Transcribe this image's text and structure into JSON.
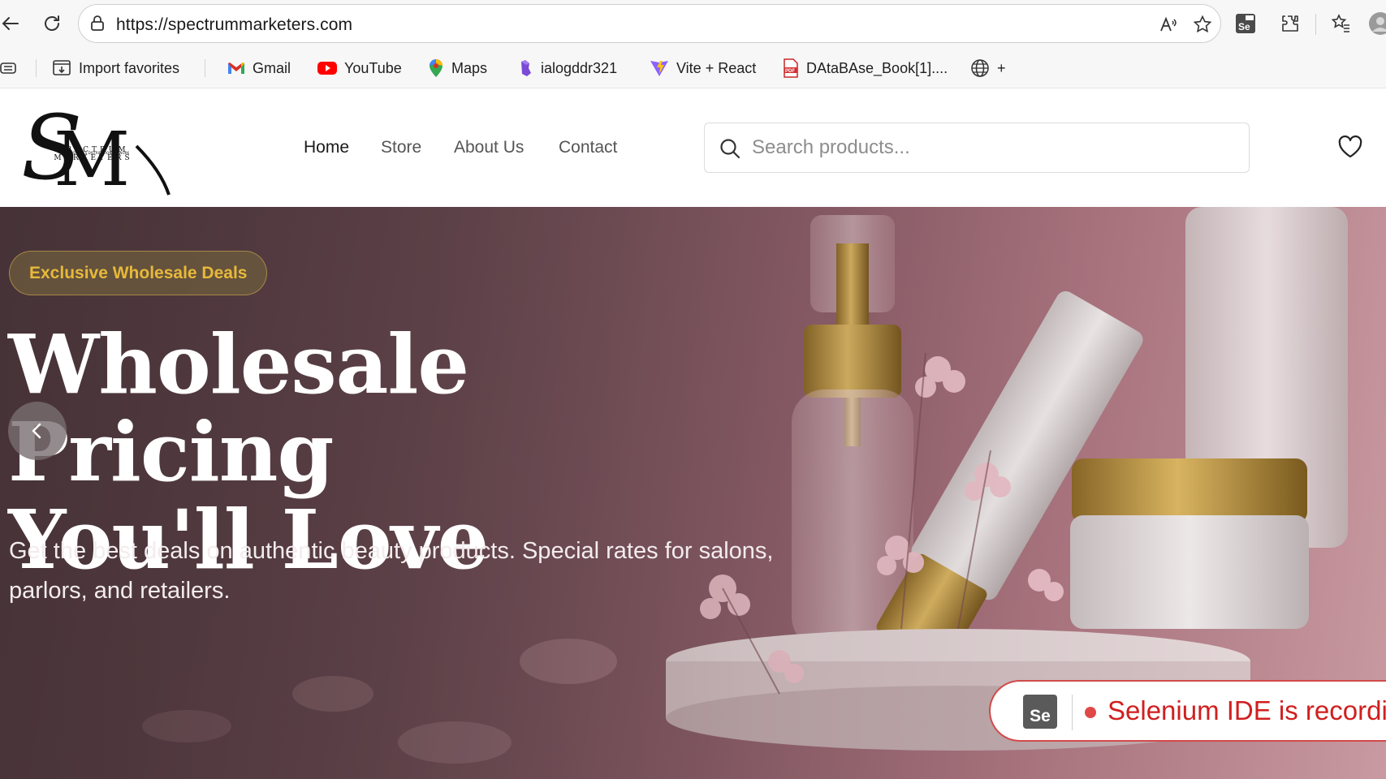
{
  "browser": {
    "url": "https://spectrummarketers.com",
    "favorites": [
      {
        "label": "Import favorites",
        "icon": "import-favorites-icon"
      },
      {
        "label": "Gmail",
        "icon": "gmail-icon"
      },
      {
        "label": "YouTube",
        "icon": "youtube-icon"
      },
      {
        "label": "Maps",
        "icon": "maps-icon"
      },
      {
        "label": "ialogddr321",
        "icon": "bookmark-icon"
      },
      {
        "label": "Vite + React",
        "icon": "vite-icon"
      },
      {
        "label": "DAtaBAse_Book[1]....",
        "icon": "pdf-icon"
      },
      {
        "label": "+",
        "icon": "globe-icon"
      }
    ]
  },
  "site": {
    "logo_letters": "SM",
    "logo_tagline": "SPECTRUM MARKETERS",
    "nav": [
      {
        "label": "Home",
        "active": true
      },
      {
        "label": "Store",
        "active": false
      },
      {
        "label": "About Us",
        "active": false
      },
      {
        "label": "Contact",
        "active": false
      }
    ],
    "search_placeholder": "Search products..."
  },
  "hero": {
    "badge": "Exclusive Wholesale Deals",
    "title_line1": "Wholesale Pricing",
    "title_line2": "You'll Love",
    "subtitle": "Get the best deals on authentic beauty products. Special rates for salons, parlors, and retailers."
  },
  "selenium": {
    "logo": "Se",
    "text": "Selenium IDE is recordi"
  },
  "colors": {
    "badge_text": "#e7b93b",
    "toast_text": "#d01f1f",
    "hero_bg": "#8e5f6a"
  }
}
